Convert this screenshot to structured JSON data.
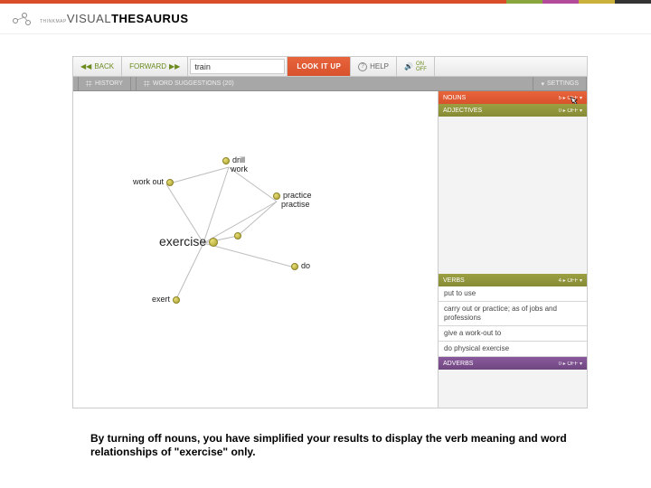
{
  "brand": {
    "thin": "VISUAL",
    "bold": "THESAURUS",
    "sub": "THINKMAP"
  },
  "toolbar": {
    "back": "BACK",
    "forward": "FORWARD",
    "search_value": "train",
    "lookup": "LOOK IT UP",
    "help": "HELP",
    "toggle_on": "ON",
    "toggle_off": "OFF"
  },
  "tabs": {
    "history": "HISTORY",
    "suggestions": "WORD SUGGESTIONS (20)",
    "settings": "SETTINGS"
  },
  "graph": {
    "center": "exercise",
    "nodes": {
      "workout": "work out",
      "drill": "drill",
      "work": "work",
      "practice": "practice",
      "practise": "practise",
      "do": "do",
      "exert": "exert"
    }
  },
  "panels": {
    "nouns": {
      "title": "NOUNS",
      "right": "5 ▸ OFF ▾"
    },
    "adjectives": {
      "title": "ADJECTIVES",
      "right": "0 ▸ OFF ▾"
    },
    "verbs": {
      "title": "VERBS",
      "right": "4 ▸ OFF ▾"
    },
    "defs": [
      "put to use",
      "carry out or practice; as of jobs and professions",
      "give a work-out to",
      "do physical exercise"
    ],
    "adverbs": {
      "title": "ADVERBS",
      "right": "0 ▸ OFF ▾"
    }
  },
  "caption": "By turning off nouns, you have simplified your results to display the verb meaning and word relationships of \"exercise\" only."
}
